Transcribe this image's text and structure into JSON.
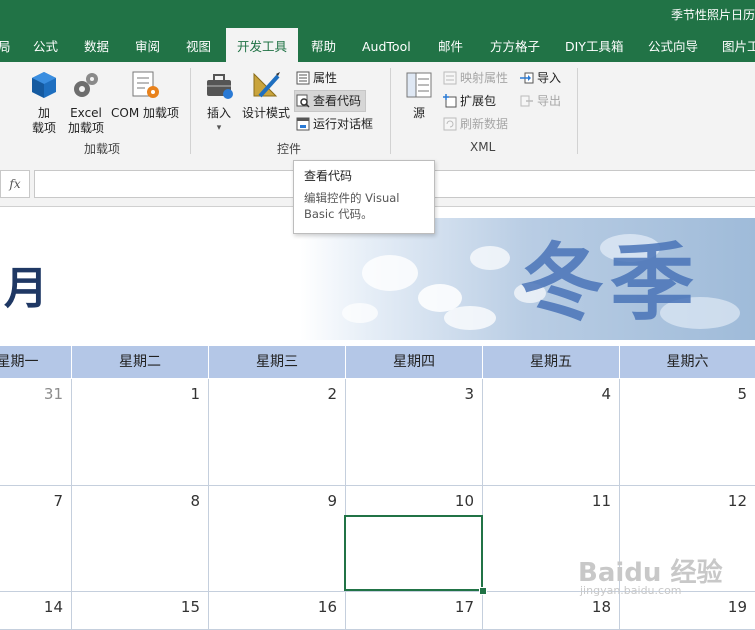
{
  "window": {
    "title": "季节性照片日历"
  },
  "tabs": [
    "局",
    "公式",
    "数据",
    "审阅",
    "视图",
    "开发工具",
    "帮助",
    "AudTool",
    "邮件",
    "方方格子",
    "DIY工具箱",
    "公式向导",
    "图片工"
  ],
  "active_tab": "开发工具",
  "ribbon": {
    "addins": {
      "group_label": "加载项",
      "addins_btn": "加\n载项",
      "excel_addins": "Excel\n加载项",
      "com_addins": "COM 加载项"
    },
    "controls": {
      "group_label": "控件",
      "insert": "插入",
      "insert_arrow": "▾",
      "design_mode": "设计模式",
      "properties": "属性",
      "view_code": "查看代码",
      "run_dialog": "运行对话框"
    },
    "xml": {
      "group_label": "XML",
      "source": "源",
      "map_properties": "映射属性",
      "expansion_packs": "扩展包",
      "refresh_data": "刷新数据",
      "import": "导入",
      "export": "导出"
    }
  },
  "formula_bar": {
    "fx": "fx",
    "value": ""
  },
  "tooltip": {
    "title": "查看代码",
    "body": "编辑控件的 Visual Basic 代码。"
  },
  "calendar": {
    "month_label": "月",
    "banner_text": "冬季",
    "days": [
      "星期一",
      "星期二",
      "星期三",
      "星期四",
      "星期五",
      "星期六"
    ],
    "rows": [
      [
        "31",
        "1",
        "2",
        "3",
        "4",
        "5"
      ],
      [
        "7",
        "8",
        "9",
        "10",
        "11",
        "12"
      ],
      [
        "14",
        "15",
        "16",
        "17",
        "18",
        "19"
      ]
    ]
  },
  "watermark": {
    "text": "Baidu 经验",
    "sub": "jingyan.baidu.com"
  },
  "colors": {
    "excel_green": "#217346",
    "header_blue": "#b4c7e7",
    "month_navy": "#1f3864"
  }
}
